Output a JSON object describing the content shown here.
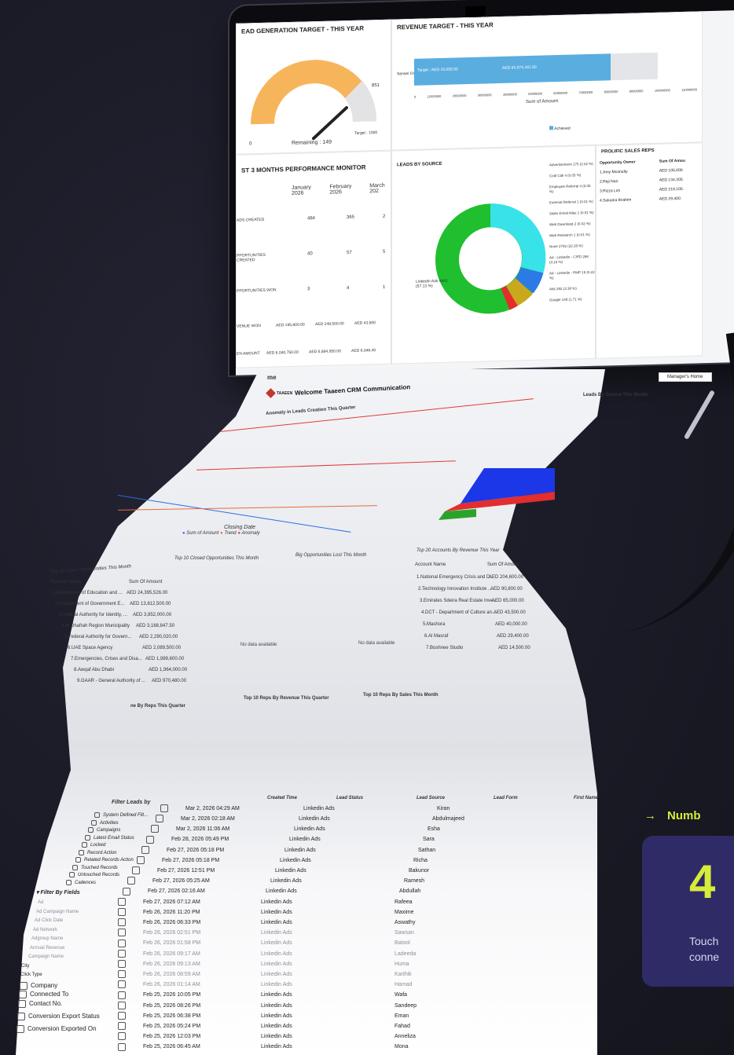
{
  "laptop": {
    "lead_gen": {
      "title": "EAD GENERATION TARGET - THIS YEAR",
      "value": "851",
      "remaining": "Remaining : 149",
      "target": "Target : 1000",
      "zero": "0"
    },
    "revenue": {
      "title": "REVENUE TARGET - THIS YEAR",
      "row_label": "Sensei Org",
      "target_label": "Target : AED 16,000.00",
      "achieved_value": "AED 83,974,441.50",
      "ticks": [
        "0",
        "15000000",
        "20000000",
        "30000000",
        "40000000",
        "50000000",
        "60000000",
        "70000000",
        "80000000",
        "90000000",
        "100000000",
        "110000000"
      ],
      "axis_label": "Sum of Amount",
      "legend": "Achieved"
    },
    "perf": {
      "title": "ST 3 MONTHS PERFORMANCE MONITOR",
      "months": [
        "January 2026",
        "February 2026",
        "March 202"
      ],
      "rows": [
        {
          "label": "ADS CREATED",
          "values": [
            "484",
            "365",
            "2"
          ]
        },
        {
          "label": "PPORTUNITIES CREATED",
          "values": [
            "40",
            "57",
            "5"
          ]
        },
        {
          "label": "PPORTUNITIES WON",
          "values": [
            "3",
            "4",
            "1"
          ]
        },
        {
          "label": "VENUE WON",
          "values": [
            "AED 195,800.00",
            "AED 248,500.00",
            "AED 43,500"
          ]
        },
        {
          "label": "EN AMOUNT",
          "values": [
            "AED 6,040,750.00",
            "AED 6,894,950.00",
            "AED 6,046,40"
          ]
        }
      ]
    },
    "sources": {
      "title": "LEADS BY SOURCE",
      "linkedin_label": "Linkedin Ads 4841 (57.13 %)",
      "labels": [
        "Advertisement 175 (2.02 %)",
        "Cold Call 4 (0.05 %)",
        "Employee Referral 4 (0.05 %)",
        "External Referral 1 (0.01 %)",
        "Sales Email Alias 1 (0.01 %)",
        "Web Download 2 (0.02 %)",
        "Web Research 1 (0.01 %)",
        "None 2792 (32.28 %)",
        "Ad - Linkedin - CIPD 268 (3.10 %)",
        "Ad - Linkedin - PMP 19 (0.22 %)",
        "Ads 292 (3.38 %)",
        "Google 148 (1.71 %)"
      ]
    },
    "reps": {
      "title": "PROLIFIC SALES REPS",
      "headers": [
        "Opportunity Owner",
        "Sum Of Amou"
      ],
      "rows": [
        [
          "1.Amy Mcanulty",
          "AED 105,000."
        ],
        [
          "2.Reji Nair",
          "AED 134,300."
        ],
        [
          "3.Rizza Lim",
          "AED 219,100."
        ],
        [
          "4.Sukaina Ibrahim",
          "AED 29,400."
        ]
      ]
    }
  },
  "sheet": {
    "home_label": "me",
    "view_select": "Manager's Home",
    "logo_text": "TAAEEN",
    "welcome": "Welcome Taaeen CRM Communication",
    "anomaly_title": "Anomaly in Leads Creation This Quarter",
    "leads_by_source_month": "Leads By Source This Month",
    "closing_date": "Closing Date",
    "legend": [
      "Sum of Amount",
      "Trend",
      "Anomaly"
    ],
    "open_opps": {
      "title": "Top 10 Open Opportunities This Month",
      "headers": [
        "Account Name",
        "Sum Of Amount"
      ],
      "rows": [
        [
          "1.Department of Education and ...",
          "AED 24,395,526.00"
        ],
        [
          "2.Department of Government E...",
          "AED 13,812,500.00"
        ],
        [
          "3.Federal Authority for Identity, ...",
          "AED 3,852,000.00"
        ],
        [
          "4.Al Dhafrah Region Municipality",
          "AED 3,168,847.50"
        ],
        [
          "5.Federal Authority for Govern...",
          "AED 2,290,020.00"
        ],
        [
          "6.UAE Space Agency",
          "AED 2,089,500.00"
        ],
        [
          "7.Emergencies, Crises and Disa...",
          "AED 1,989,600.00"
        ],
        [
          "8.Awqaf Abu Dhabi",
          "AED 1,964,000.00"
        ],
        [
          "9.GAAR - General Authority of ...",
          "AED 970,480.00"
        ]
      ]
    },
    "closed_opps_title": "Top 10 Closed Opportunities This Month",
    "big_opps_title": "Big Opportunities Lost This Month",
    "no_data": "No data available",
    "accounts": {
      "title": "Top 20 Accounts By Revenue This Year",
      "headers": [
        "Account Name",
        "Sum Of Amoun"
      ],
      "rows": [
        [
          "1.National Emergency Crisis and D...",
          "AED 204,600.00"
        ],
        [
          "2.Technology Innovation Institute ...",
          "AED 90,800.00"
        ],
        [
          "3.Emirates Sdeira Real Estate Inve...",
          "AED 65,000.00"
        ],
        [
          "4.DCT - Department of Culture an...",
          "AED 43,500.00"
        ],
        [
          "5.Mashora",
          "AED 40,000.00"
        ],
        [
          "6.Al Masraf",
          "AED 29,400.00"
        ],
        [
          "7.Boshnee Studio",
          "AED 14,500.00"
        ]
      ]
    },
    "reps_quarter_title": "ne By Reps This Quarter",
    "reps_revenue_title": "Top 10 Reps By Revenue This Quarter",
    "reps_sales_title": "Top 10 Reps By Sales This Month",
    "leads_table": {
      "headers": [
        "Created Time",
        "Lead Status",
        "Lead Source",
        "Lead Form",
        "First Name"
      ],
      "rows": [
        [
          "Mar 2, 2026 04:29 AM",
          "Linkedin Ads",
          "Kiran"
        ],
        [
          "Mar 2, 2026 02:18 AM",
          "Linkedin Ads",
          "Abdulmajeed"
        ],
        [
          "Mar 2, 2026 11:06 AM",
          "Linkedin Ads",
          "Esha"
        ],
        [
          "Feb 28, 2026 05:49 PM",
          "Linkedin Ads",
          "Sara"
        ],
        [
          "Feb 27, 2026 05:18 PM",
          "Linkedin Ads",
          "Sathan"
        ],
        [
          "Feb 27, 2026 05:18 PM",
          "Linkedin Ads",
          "Richa"
        ],
        [
          "Feb 27, 2026 12:51 PM",
          "Linkedin Ads",
          "Bakunor"
        ],
        [
          "Feb 27, 2026 05:25 AM",
          "Linkedin Ads",
          "Ramesh"
        ],
        [
          "Feb 27, 2026 02:16 AM",
          "Linkedin Ads",
          "Abdullah"
        ],
        [
          "Feb 27, 2026 07:12 AM",
          "Linkedin Ads",
          "Rafeea"
        ],
        [
          "Feb 26, 2026 11:20 PM",
          "Linkedin Ads",
          "Maxime"
        ],
        [
          "Feb 26, 2026 06:33 PM",
          "Linkedin Ads",
          "Aswathy"
        ],
        [
          "Feb 26, 2026 02:51 PM",
          "Linkedin Ads",
          "Sawsan"
        ],
        [
          "Feb 26, 2026 01:58 PM",
          "Linkedin Ads",
          "Batool"
        ],
        [
          "Feb 26, 2026 09:17 AM",
          "Linkedin Ads",
          "Ladeeda"
        ],
        [
          "Feb 26, 2026 09:13 AM",
          "Linkedin Ads",
          "Huma"
        ],
        [
          "Feb 26, 2026 08:59 AM",
          "Linkedin Ads",
          "Karthik"
        ],
        [
          "Feb 26, 2026 01:14 AM",
          "Linkedin Ads",
          "Hamad"
        ],
        [
          "Feb 25, 2026 10:05 PM",
          "Linkedin Ads",
          "Wafa"
        ],
        [
          "Feb 25, 2026 08:26 PM",
          "Linkedin Ads",
          "Sandeep"
        ],
        [
          "Feb 25, 2026 06:38 PM",
          "Linkedin Ads",
          "Eman"
        ],
        [
          "Feb 25, 2026 05:24 PM",
          "Linkedin Ads",
          "Fahad"
        ],
        [
          "Feb 25, 2026 12:03 PM",
          "Linkedin Ads",
          "Anneliza"
        ],
        [
          "Feb 25, 2026 06:45 AM",
          "Linkedin Ads",
          "Mona"
        ]
      ]
    },
    "filters": {
      "title": "Filter Leads by",
      "system": [
        "System Defined Filt...",
        "Activities",
        "Campaigns",
        "Latest Email Status",
        "Locked",
        "Record Action",
        "Related Records Action",
        "Touched Records",
        "Untouched Records",
        "Cadences"
      ],
      "by_fields_title": "Filter By Fields",
      "fields": [
        "Ad",
        "Ad Campaign Name",
        "Ad Click Date",
        "Ad Network",
        "Adgroup Name",
        "Annual Revenue",
        "Campaign Name",
        "City",
        "Click Type",
        "Company",
        "Connected To",
        "Contact No.",
        "Conversion Export Status",
        "Conversion Exported On"
      ]
    }
  },
  "promo": {
    "heading": "Numb",
    "arrow": "→",
    "number": "4",
    "text_lines": [
      "Touch",
      "conne"
    ]
  }
}
